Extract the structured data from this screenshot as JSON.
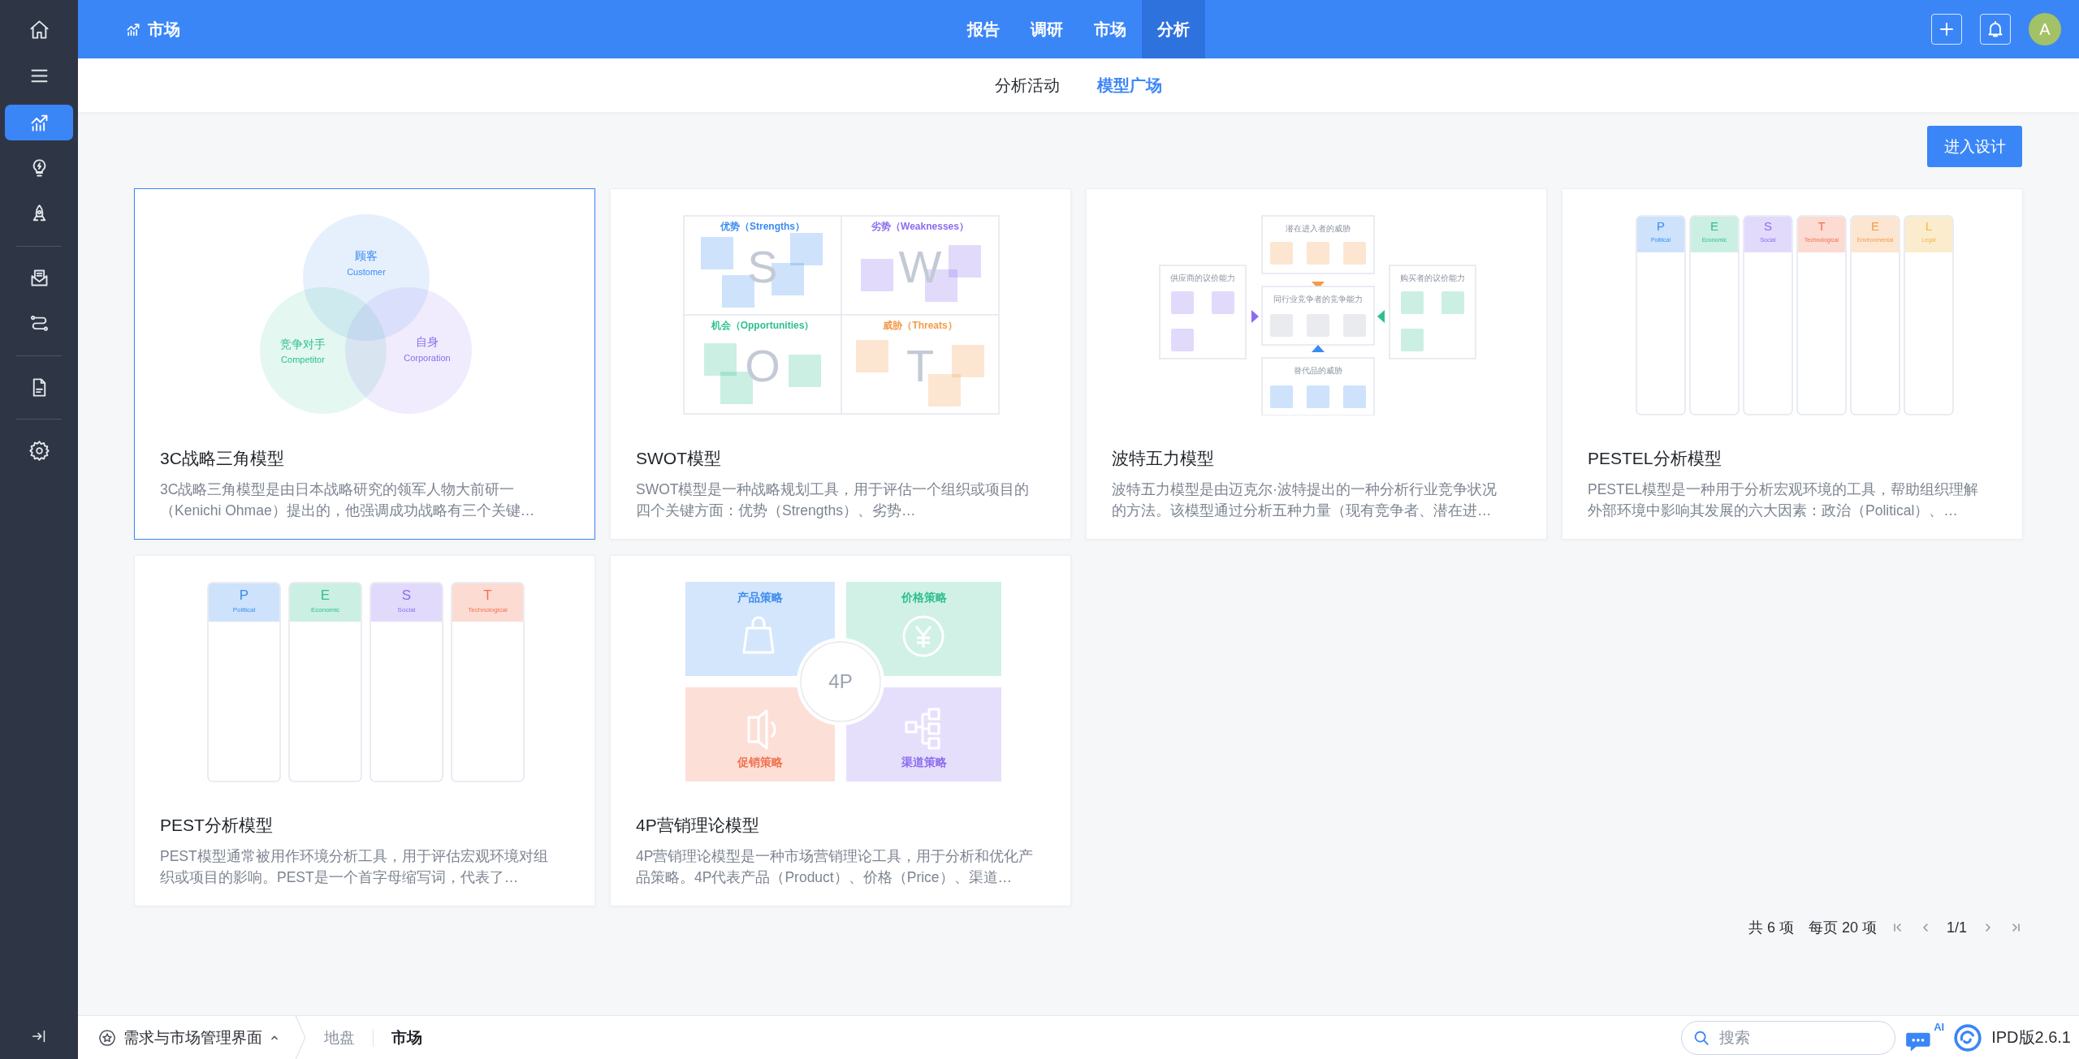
{
  "sidebar": {
    "groups": [
      {
        "items": [
          {
            "selected": false
          },
          {
            "selected": false
          },
          {
            "selected": true
          },
          {
            "selected": false
          },
          {
            "selected": false
          }
        ]
      },
      {
        "items": [
          {
            "selected": false
          },
          {
            "selected": false
          }
        ]
      },
      {
        "items": [
          {
            "selected": false
          }
        ]
      },
      {
        "items": [
          {
            "selected": false
          }
        ]
      }
    ]
  },
  "topbar": {
    "module": "市场",
    "nav": [
      {
        "label": "报告",
        "selected": false
      },
      {
        "label": "调研",
        "selected": false
      },
      {
        "label": "市场",
        "selected": false
      },
      {
        "label": "分析",
        "selected": true
      }
    ],
    "avatar": "A"
  },
  "subnav": [
    {
      "label": "分析活动",
      "selected": false
    },
    {
      "label": "模型广场",
      "selected": true
    }
  ],
  "design_button": "进入设计",
  "cards": [
    {
      "title": "3C战略三角模型",
      "description": "3C战略三角模型是由日本战略研究的领军人物大前研一（Kenichi Ohmae）提出的，他强调成功战略有三个关键…",
      "selected": true,
      "preview": {
        "kind": "venn",
        "circles": [
          {
            "title": "顾客",
            "subtitle": "Customer",
            "color": "#3b8cf0"
          },
          {
            "title": "竞争对手",
            "subtitle": "Competitor",
            "color": "#2fbf8f"
          },
          {
            "title": "自身",
            "subtitle": "Corporation",
            "color": "#8b6cf0"
          }
        ]
      }
    },
    {
      "title": "SWOT模型",
      "description": "SWOT模型是一种战略规划工具，用于评估一个组织或项目的四个关键方面：优势（Strengths）、劣势…",
      "selected": false,
      "preview": {
        "kind": "swot",
        "quadrants": [
          {
            "label": "优势（Strengths）",
            "letter": "S",
            "color": "#3b8cf0"
          },
          {
            "label": "劣势（Weaknesses）",
            "letter": "W",
            "color": "#8b6cf0"
          },
          {
            "label": "机会（Opportunities）",
            "letter": "O",
            "color": "#2fbf8f"
          },
          {
            "label": "威胁（Threats）",
            "letter": "T",
            "color": "#f59a4a"
          }
        ]
      }
    },
    {
      "title": "波特五力模型",
      "description": "波特五力模型是由迈克尔·波特提出的一种分析行业竞争状况的方法。该模型通过分析五种力量（现有竞争者、潜在进…",
      "selected": false,
      "preview": {
        "kind": "five_forces",
        "boxes": [
          {
            "label": "潜在进入者的威胁",
            "color": "#f59a4a"
          },
          {
            "label": "供应商的议价能力",
            "color": "#8b6cf0"
          },
          {
            "label": "同行业竞争者的竞争能力",
            "color": "#e9ebef"
          },
          {
            "label": "购买者的议价能力",
            "color": "#2fbf8f"
          },
          {
            "label": "替代品的威胁",
            "color": "#3b8cf0"
          }
        ]
      }
    },
    {
      "title": "PESTEL分析模型",
      "description": "PESTEL模型是一种用于分析宏观环境的工具，帮助组织理解外部环境中影响其发展的六大因素：政治（Political）、…",
      "selected": false,
      "preview": {
        "kind": "columns",
        "columns": [
          {
            "letter": "P",
            "name": "Political",
            "color": "#3b8cf0"
          },
          {
            "letter": "E",
            "name": "Economic",
            "color": "#2fbf8f"
          },
          {
            "letter": "S",
            "name": "Social",
            "color": "#8b6cf0"
          },
          {
            "letter": "T",
            "name": "Technological",
            "color": "#f2714f"
          },
          {
            "letter": "E",
            "name": "Environmental",
            "color": "#f59a4a"
          },
          {
            "letter": "L",
            "name": "Legal",
            "color": "#f5b53d"
          }
        ]
      }
    },
    {
      "title": "PEST分析模型",
      "description": "PEST模型通常被用作环境分析工具，用于评估宏观环境对组织或项目的影响。PEST是一个首字母缩写词，代表了…",
      "selected": false,
      "preview": {
        "kind": "columns",
        "columns": [
          {
            "letter": "P",
            "name": "Political",
            "color": "#3b8cf0"
          },
          {
            "letter": "E",
            "name": "Economic",
            "color": "#2fbf8f"
          },
          {
            "letter": "S",
            "name": "Social",
            "color": "#8b6cf0"
          },
          {
            "letter": "T",
            "name": "Technological",
            "color": "#f2714f"
          }
        ]
      }
    },
    {
      "title": "4P营销理论模型",
      "description": "4P营销理论模型是一种市场营销理论工具，用于分析和优化产品策略。4P代表产品（Product）、价格（Price）、渠道…",
      "selected": false,
      "preview": {
        "kind": "four_p",
        "center": "4P",
        "quadrants": [
          {
            "label": "产品策略",
            "color": "#3b8cf0"
          },
          {
            "label": "价格策略",
            "color": "#2fbf8f"
          },
          {
            "label": "促销策略",
            "color": "#f2714f"
          },
          {
            "label": "渠道策略",
            "color": "#8b6cf0"
          }
        ]
      }
    }
  ],
  "pagination": {
    "total": "共 6 项",
    "per_page": "每页 20 项",
    "page": "1/1"
  },
  "footer": {
    "workspace": "需求与市场管理界面",
    "breadcrumbs": [
      {
        "label": "地盘",
        "selected": false
      },
      {
        "label": "市场",
        "selected": true
      }
    ],
    "search": {
      "placeholder": "搜索"
    },
    "ai_badge": "AI",
    "version": "IPD版2.6.1"
  }
}
